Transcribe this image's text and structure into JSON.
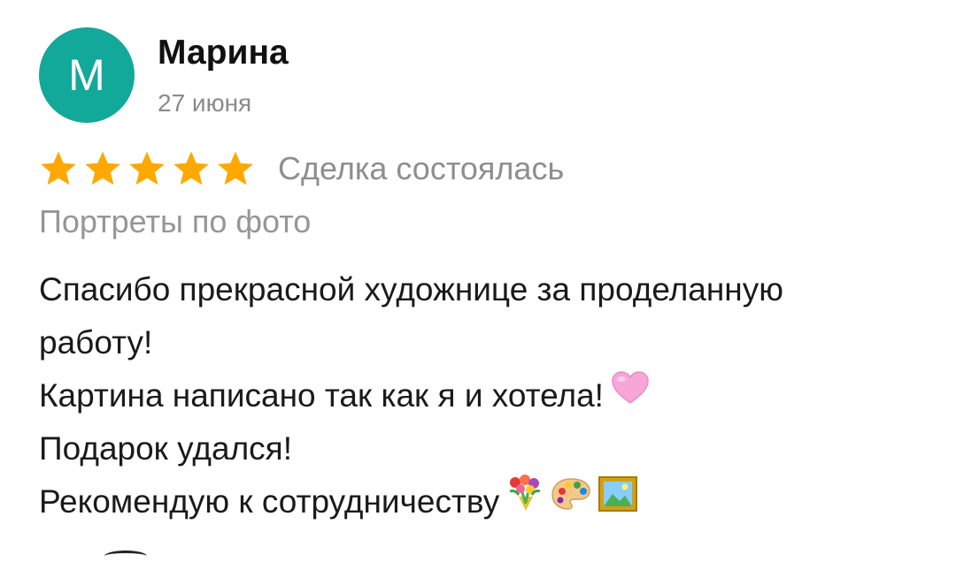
{
  "review": {
    "avatar_letter": "M",
    "author_name": "Марина",
    "date": "27 июня",
    "rating": 5,
    "max_rating": 5,
    "deal_status": "Сделка состоялась",
    "service": "Портреты по фото",
    "lines": [
      "Спасибо прекрасной художнице за проделанную",
      "работу!",
      "Картина написано так как я и хотела!",
      "Подарок удался!",
      "Рекомендую к сотрудничеству"
    ],
    "emojis": {
      "line_3": [
        "pink-heart-icon"
      ],
      "line_5": [
        "bouquet-icon",
        "artist-palette-icon",
        "framed-picture-icon"
      ]
    }
  },
  "colors": {
    "avatar_bg": "#12a89a",
    "star": "#ffa800",
    "heart": "#f7a6d8"
  }
}
